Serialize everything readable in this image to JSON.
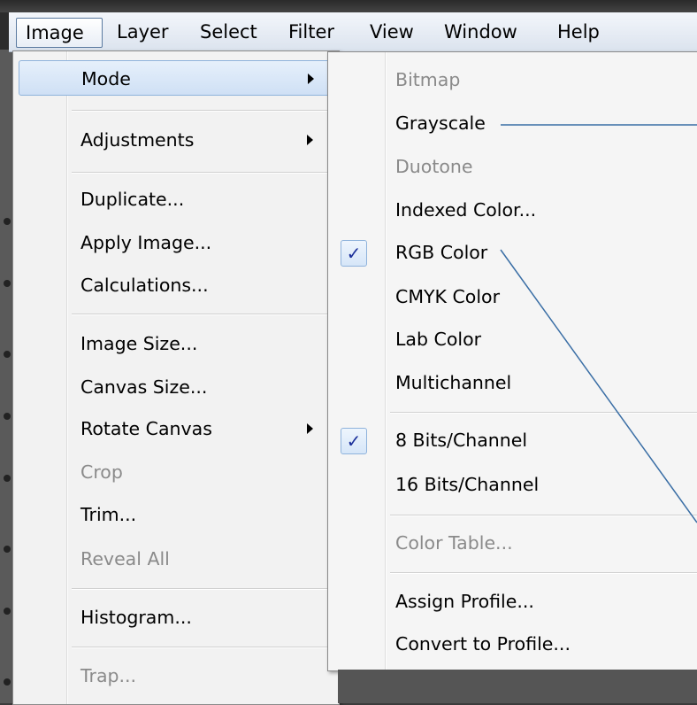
{
  "menubar": {
    "items": [
      {
        "label": "Image",
        "active": true
      },
      {
        "label": "Layer"
      },
      {
        "label": "Select"
      },
      {
        "label": "Filter"
      },
      {
        "label": "View"
      },
      {
        "label": "Window"
      },
      {
        "label": "Help"
      }
    ]
  },
  "image_menu": {
    "items": [
      {
        "label": "Mode",
        "submenu": true,
        "highlighted": true
      },
      {
        "label": "Adjustments",
        "submenu": true
      },
      {
        "label": "Duplicate..."
      },
      {
        "label": "Apply Image..."
      },
      {
        "label": "Calculations..."
      },
      {
        "label": "Image Size..."
      },
      {
        "label": "Canvas Size..."
      },
      {
        "label": "Rotate Canvas",
        "submenu": true
      },
      {
        "label": "Crop",
        "disabled": true
      },
      {
        "label": "Trim..."
      },
      {
        "label": "Reveal All",
        "disabled": true
      },
      {
        "label": "Histogram..."
      },
      {
        "label": "Trap...",
        "disabled": true
      }
    ]
  },
  "mode_menu": {
    "items": [
      {
        "label": "Bitmap",
        "disabled": true
      },
      {
        "label": "Grayscale"
      },
      {
        "label": "Duotone",
        "disabled": true
      },
      {
        "label": "Indexed Color..."
      },
      {
        "label": "RGB Color",
        "checked": true
      },
      {
        "label": "CMYK Color"
      },
      {
        "label": "Lab Color"
      },
      {
        "label": "Multichannel"
      },
      {
        "label": "8 Bits/Channel",
        "checked": true
      },
      {
        "label": "16 Bits/Channel"
      },
      {
        "label": "Color Table...",
        "disabled": true
      },
      {
        "label": "Assign Profile..."
      },
      {
        "label": "Convert to Profile..."
      }
    ],
    "check_glyph": "✓"
  },
  "colors": {
    "check": "#1a2f9a",
    "callout_line": "#3a6ea5",
    "disabled_text": "#8a8a8a"
  }
}
